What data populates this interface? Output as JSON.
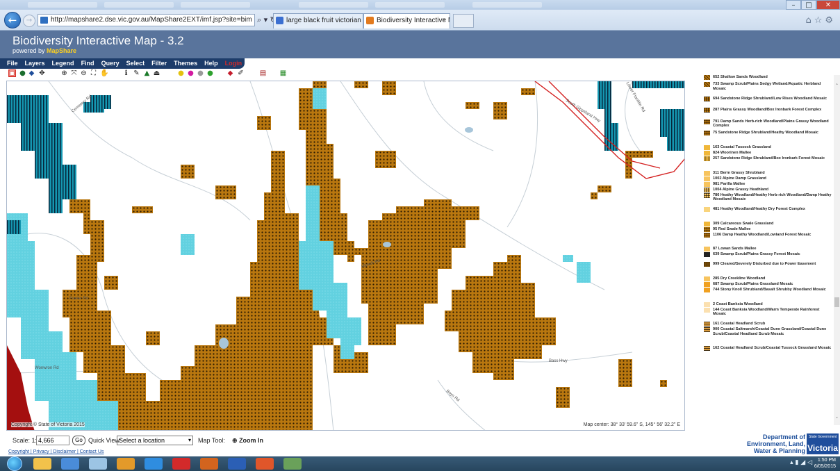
{
  "browser": {
    "address": "http://mapshare2.dse.vic.gov.au/MapShare2EXT/imf.jsp?site=bim",
    "tabs": [
      {
        "label": "large black fruit victorian weed..."
      },
      {
        "label": "Biodiversity Interactive Map"
      }
    ],
    "tab_close": "×"
  },
  "app": {
    "title": "Biodiversity Interactive Map - 3.2",
    "powered_by": "powered by",
    "brand": "MapShare"
  },
  "menu": {
    "items": [
      "File",
      "Layers",
      "Legend",
      "Find",
      "Query",
      "Select",
      "Filter",
      "Themes",
      "Help"
    ],
    "login": "Login"
  },
  "toolbar": {
    "icons": [
      "overview-icon",
      "globe-icon",
      "bookmark-icon",
      "pan-icon",
      "zoom-in-icon",
      "zoom-full-icon",
      "zoom-out-icon",
      "zoom-extent-icon",
      "hand-icon",
      "info-icon",
      "measure-icon",
      "layers-icon",
      "print-area-icon",
      "pin-yellow-icon",
      "pin-magenta-icon",
      "pin-grey-icon",
      "pin-green-icon",
      "erase-icon",
      "draw-icon",
      "print-icon",
      "export-icon"
    ]
  },
  "map": {
    "copyright": "Copyright © State of Victoria 2015",
    "center_readout": "Map center: 38° 33' 59.6\" S, 145° 56' 32.2\" E",
    "road_labels": [
      "Cemetery Rd",
      "Wonwron Rd",
      "Fowler Rd",
      "South Gippsland Hwy",
      "Bass Hwy",
      "Lower Franklin Rd",
      "Boys Rd",
      "Hlesch Rd"
    ],
    "colors": {
      "woodland": "#b9770f",
      "wetland": "#5fd0df",
      "teal_hatch": "#1797b0",
      "boundary": "#d42020",
      "cleared": "#a50e0e"
    }
  },
  "legend": {
    "items": [
      {
        "code": "cut",
        "label": "652 Shallow Sands Woodland",
        "color": "#b9770f",
        "pattern": "hatch"
      },
      {
        "label": "733 Swamp Scrub/Plains Sedgy Wetland/Aquatic Herbland Mosaic",
        "color": "#b9770f",
        "pattern": "hatch"
      },
      {
        "label": "694 Sandstone Ridge Shrubland/Low Rises Woodland Mosaic",
        "color": "#b9770f",
        "pattern": "grid"
      },
      {
        "label": "287 Plains Grassy Woodland/Box Ironbark Forest Complex",
        "color": "#b9770f",
        "pattern": "grid"
      },
      {
        "label": "791 Damp Sands Herb-rich Woodland/Plains Grassy Woodland Complex",
        "color": "#b9770f",
        "pattern": "dots"
      },
      {
        "label": "75 Sandstone Ridge Shrubland/Heathy Woodland Mosaic",
        "color": "#b9770f",
        "pattern": "dots"
      },
      {
        "label": "163 Coastal Tussock Grassland",
        "color": "#f0b73a",
        "pattern": "solid"
      },
      {
        "label": "824 Woorinen Mallee",
        "color": "#f0b73a",
        "pattern": "solid"
      },
      {
        "label": "257 Sandstone Ridge Shrubland/Box Ironbark Forest Mosaic",
        "color": "#f0b73a",
        "pattern": "vlines"
      },
      {
        "label": "311 Berm Grassy Shrubland",
        "color": "#f7c45e",
        "pattern": "solid"
      },
      {
        "label": "1002 Alpine Damp Grassland",
        "color": "#f7c45e",
        "pattern": "solid"
      },
      {
        "label": "981 Parilla Mallee",
        "color": "#f7c45e",
        "pattern": "solid"
      },
      {
        "label": "1004 Alpine Grassy Heathland",
        "color": "#f7c45e",
        "pattern": "grid"
      },
      {
        "label": "786 Heathy Woodland/Heathy Herb-rich Woodland/Damp Heathy Woodland Mosaic",
        "color": "#f7c45e",
        "pattern": "grid"
      },
      {
        "label": "481 Heathy Woodland/Heathy Dry Forest Complex",
        "color": "#f9d47c",
        "pattern": "solid"
      },
      {
        "label": "309 Calcareous Swale Grassland",
        "color": "#f0b73a",
        "pattern": "solid"
      },
      {
        "label": "95 Red Swale Mallee",
        "color": "#c9850e",
        "pattern": "dots"
      },
      {
        "label": "1106 Damp Heathy Woodland/Lowland Forest Mosaic",
        "color": "#b9770f",
        "pattern": "dots"
      },
      {
        "label": "87 Lowan Sands Mallee",
        "color": "#f7c45e",
        "pattern": "solid"
      },
      {
        "label": "639 Swamp Scrub/Plains Grassy Forest Mosaic",
        "color": "#222222",
        "pattern": "solid"
      },
      {
        "label": "999 Cleared/Severely Disturbed due to Power Easement",
        "color": "#8a5a0a",
        "pattern": "dots"
      },
      {
        "label": "285 Dry Creekline Woodland",
        "color": "#f7c45e",
        "pattern": "solid"
      },
      {
        "label": "687 Swamp Scrub/Plains Grassland Mosaic",
        "color": "#f0a020",
        "pattern": "solid"
      },
      {
        "label": "744 Stony Knoll Shrubland/Basalt Shrubby Woodland Mosaic",
        "color": "#f0a020",
        "pattern": "solid"
      },
      {
        "label": "2 Coast Banksia Woodland",
        "color": "#fbe0b0",
        "pattern": "solid"
      },
      {
        "label": "144 Coast Banksia Woodland/Warm Temperate Rainforest Mosaic",
        "color": "#fbe0b0",
        "pattern": "solid"
      },
      {
        "label": "161 Coastal Headland Scrub",
        "color": "#d89a3c",
        "pattern": "hlines"
      },
      {
        "label": "900 Coastal Saltmarsh/Coastal Dune Grassland/Coastal Dune Scrub/Coastal Headland Scrub Mosaic",
        "color": "#d89a3c",
        "pattern": "hlines"
      },
      {
        "label": "162 Coastal Headland Scrub/Coastal Tussock Grassland Mosaic",
        "color": "#d89a3c",
        "pattern": "hlines"
      }
    ]
  },
  "bottom": {
    "scale_label": "Scale: 1:",
    "scale_value": "4,666",
    "go": "Go",
    "quick_view_label": "Quick View:",
    "quick_view_value": "Select a location",
    "map_tool_label": "Map Tool:",
    "map_tool_value": "Zoom In",
    "links": [
      "Copyright",
      "Privacy",
      "Disclaimer",
      "Contact Us"
    ],
    "dept": [
      "Department of",
      "Environment, Land,",
      "Water & Planning"
    ],
    "state_mark": "Victoria",
    "state_small": "State Government"
  },
  "taskbar": {
    "time": "1:50 PM",
    "date": "6/05/2015"
  }
}
